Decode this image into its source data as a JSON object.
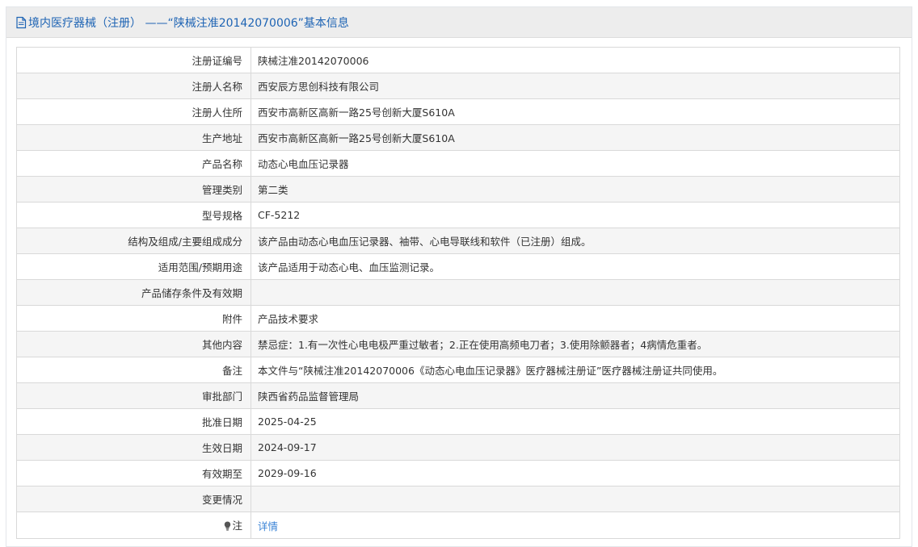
{
  "header": {
    "title": "境内医疗器械（注册） ——“陕械注准20142070006”基本信息",
    "icon": "document-icon"
  },
  "rows": [
    {
      "label": "注册证编号",
      "value": "陕械注准20142070006"
    },
    {
      "label": "注册人名称",
      "value": "西安辰方思创科技有限公司"
    },
    {
      "label": "注册人住所",
      "value": "西安市高新区高新一路25号创新大厦S610A"
    },
    {
      "label": "生产地址",
      "value": "西安市高新区高新一路25号创新大厦S610A"
    },
    {
      "label": "产品名称",
      "value": "动态心电血压记录器"
    },
    {
      "label": "管理类别",
      "value": "第二类"
    },
    {
      "label": "型号规格",
      "value": "CF-5212"
    },
    {
      "label": "结构及组成/主要组成成分",
      "value": "该产品由动态心电血压记录器、袖带、心电导联线和软件（已注册）组成。"
    },
    {
      "label": "适用范围/预期用途",
      "value": "该产品适用于动态心电、血压监测记录。"
    },
    {
      "label": "产品储存条件及有效期",
      "value": ""
    },
    {
      "label": "附件",
      "value": "产品技术要求"
    },
    {
      "label": "其他内容",
      "value": "禁忌症：1.有一次性心电电极严重过敏者；2.正在使用高频电刀者；3.使用除颤器者；4病情危重者。"
    },
    {
      "label": "备注",
      "value": "本文件与“陕械注准20142070006《动态心电血压记录器》医疗器械注册证”医疗器械注册证共同使用。"
    },
    {
      "label": "审批部门",
      "value": "陕西省药品监督管理局"
    },
    {
      "label": "批准日期",
      "value": "2025-04-25"
    },
    {
      "label": "生效日期",
      "value": "2024-09-17"
    },
    {
      "label": "有效期至",
      "value": "2029-09-16"
    },
    {
      "label": "变更情况",
      "value": ""
    }
  ],
  "note": {
    "label": "注",
    "icon": "lightbulb-icon",
    "link_text": "详情"
  },
  "colors": {
    "header_text": "#1e64b4",
    "link": "#3a83d6",
    "header_bg": "#ededed"
  }
}
